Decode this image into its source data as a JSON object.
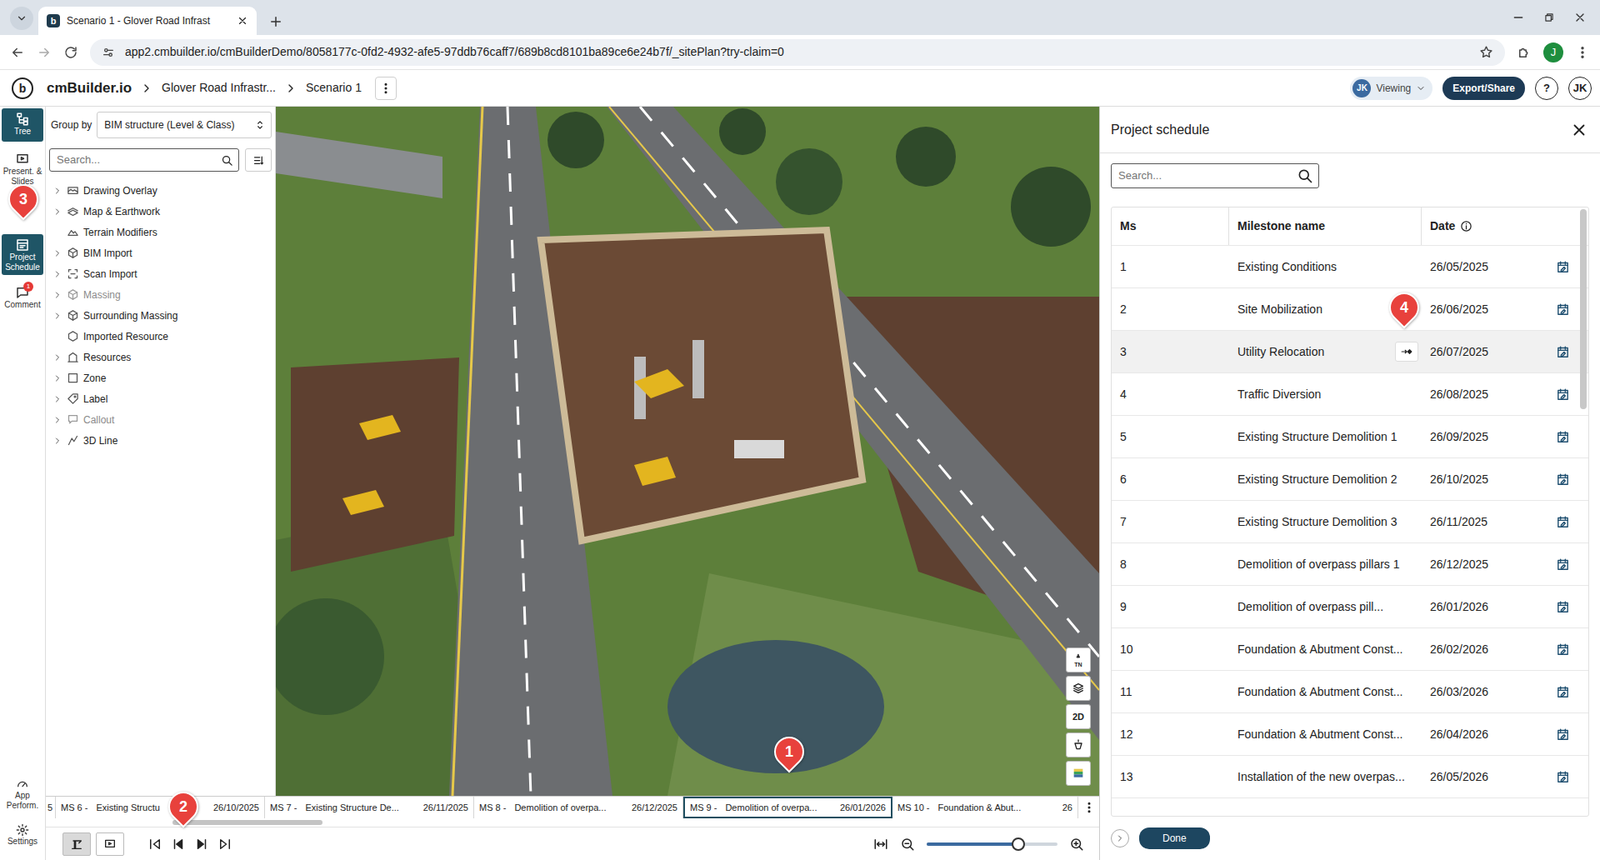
{
  "browser": {
    "tabs": [
      {
        "title": "Scenario 1 - Glover Road Infrast",
        "selected": true
      }
    ],
    "url": "app2.cmbuilder.io/cmBuilderDemo/8058177c-0fd2-4932-afe5-97ddb76caff7/689b8cd8101ba89ce6e24b7f/_sitePlan?try-claim=0",
    "profile": "J"
  },
  "header": {
    "logo_mark": "b",
    "app_name": "cmBuilder.io",
    "breadcrumbs": [
      "Glover Road Infrastr...",
      "Scenario 1"
    ],
    "viewer": {
      "initials": "JK",
      "label": "Viewing"
    },
    "export_button": "Export/Share",
    "help": "?",
    "user": "JK"
  },
  "rail": {
    "items": [
      {
        "label": "Tree",
        "selected": true
      },
      {
        "label": "Present. & Slides",
        "selected": false
      },
      {
        "label": "Project Schedule",
        "selected": true
      },
      {
        "label": "Comment",
        "selected": false,
        "badge": "1"
      }
    ],
    "bottom": [
      {
        "label": "App Perform."
      },
      {
        "label": "Settings"
      }
    ]
  },
  "tree": {
    "group_by_label": "Group by",
    "group_by_value": "BIM structure (Level & Class)",
    "search_placeholder": "Search...",
    "items": [
      {
        "label": "Drawing Overlay",
        "expandable": true,
        "disabled": false
      },
      {
        "label": "Map & Earthwork",
        "expandable": true,
        "disabled": false
      },
      {
        "label": "Terrain Modifiers",
        "expandable": false,
        "disabled": false
      },
      {
        "label": "BIM Import",
        "expandable": true,
        "disabled": false
      },
      {
        "label": "Scan Import",
        "expandable": true,
        "disabled": false
      },
      {
        "label": "Massing",
        "expandable": true,
        "disabled": true
      },
      {
        "label": "Surrounding Massing",
        "expandable": true,
        "disabled": false
      },
      {
        "label": "Imported Resource",
        "expandable": false,
        "disabled": false
      },
      {
        "label": "Resources",
        "expandable": true,
        "disabled": false
      },
      {
        "label": "Zone",
        "expandable": true,
        "disabled": false
      },
      {
        "label": "Label",
        "expandable": true,
        "disabled": false
      },
      {
        "label": "Callout",
        "expandable": true,
        "disabled": true
      },
      {
        "label": "3D Line",
        "expandable": true,
        "disabled": false
      }
    ]
  },
  "viewport": {
    "nav_buttons": [
      {
        "kind": "compass",
        "label": "TN"
      },
      {
        "kind": "layers"
      },
      {
        "kind": "text",
        "label": "2D"
      },
      {
        "kind": "sun"
      },
      {
        "kind": "palette"
      }
    ]
  },
  "timeline": {
    "items": [
      {
        "kind": "fragment",
        "date": "5",
        "selected": false
      },
      {
        "kind": "milestone",
        "ms": "MS 6 -",
        "name": "Existing Structu",
        "date": "26/10/2025",
        "selected": false
      },
      {
        "kind": "milestone",
        "ms": "MS 7 -",
        "name": "Existing Structure De...",
        "date": "26/11/2025",
        "selected": false
      },
      {
        "kind": "milestone",
        "ms": "MS 8 -",
        "name": "Demolition of overpa...",
        "date": "26/12/2025",
        "selected": false
      },
      {
        "kind": "milestone",
        "ms": "MS 9 -",
        "name": "Demolition of overpa...",
        "date": "26/01/2026",
        "selected": true
      },
      {
        "kind": "milestone",
        "ms": "MS 10 -",
        "name": "Foundation & Abut...",
        "date": "26",
        "selected": false
      }
    ],
    "scroll_level": 0.14
  },
  "controls": {
    "view_toggles": [
      {
        "selected": true
      },
      {
        "selected": false
      }
    ],
    "zoom_level": 0.7
  },
  "schedule": {
    "title": "Project schedule",
    "search_placeholder": "Search...",
    "columns": [
      "Ms",
      "Milestone name",
      "Date"
    ],
    "rows": [
      {
        "ms": "1",
        "name": "Existing Conditions",
        "date": "26/05/2025",
        "hovered": false
      },
      {
        "ms": "2",
        "name": "Site Mobilization",
        "date": "26/06/2025",
        "hovered": false
      },
      {
        "ms": "3",
        "name": "Utility Relocation",
        "date": "26/07/2025",
        "hovered": true
      },
      {
        "ms": "4",
        "name": "Traffic Diversion",
        "date": "26/08/2025",
        "hovered": false
      },
      {
        "ms": "5",
        "name": "Existing Structure Demolition 1",
        "date": "26/09/2025",
        "hovered": false
      },
      {
        "ms": "6",
        "name": "Existing Structure Demolition 2",
        "date": "26/10/2025",
        "hovered": false
      },
      {
        "ms": "7",
        "name": "Existing Structure Demolition 3",
        "date": "26/11/2025",
        "hovered": false
      },
      {
        "ms": "8",
        "name": "Demolition of overpass pillars 1",
        "date": "26/12/2025",
        "hovered": false
      },
      {
        "ms": "9",
        "name": "Demolition of overpass pill...",
        "date": "26/01/2026",
        "hovered": false
      },
      {
        "ms": "10",
        "name": "Foundation & Abutment Const...",
        "date": "26/02/2026",
        "hovered": false
      },
      {
        "ms": "11",
        "name": "Foundation & Abutment Const...",
        "date": "26/03/2026",
        "hovered": false
      },
      {
        "ms": "12",
        "name": "Foundation & Abutment Const...",
        "date": "26/04/2026",
        "hovered": false
      },
      {
        "ms": "13",
        "name": "Installation of the new overpas...",
        "date": "26/05/2026",
        "hovered": false
      }
    ],
    "scroll_level": 0.0,
    "done": "Done"
  },
  "markers": [
    "1",
    "2",
    "3",
    "4"
  ]
}
